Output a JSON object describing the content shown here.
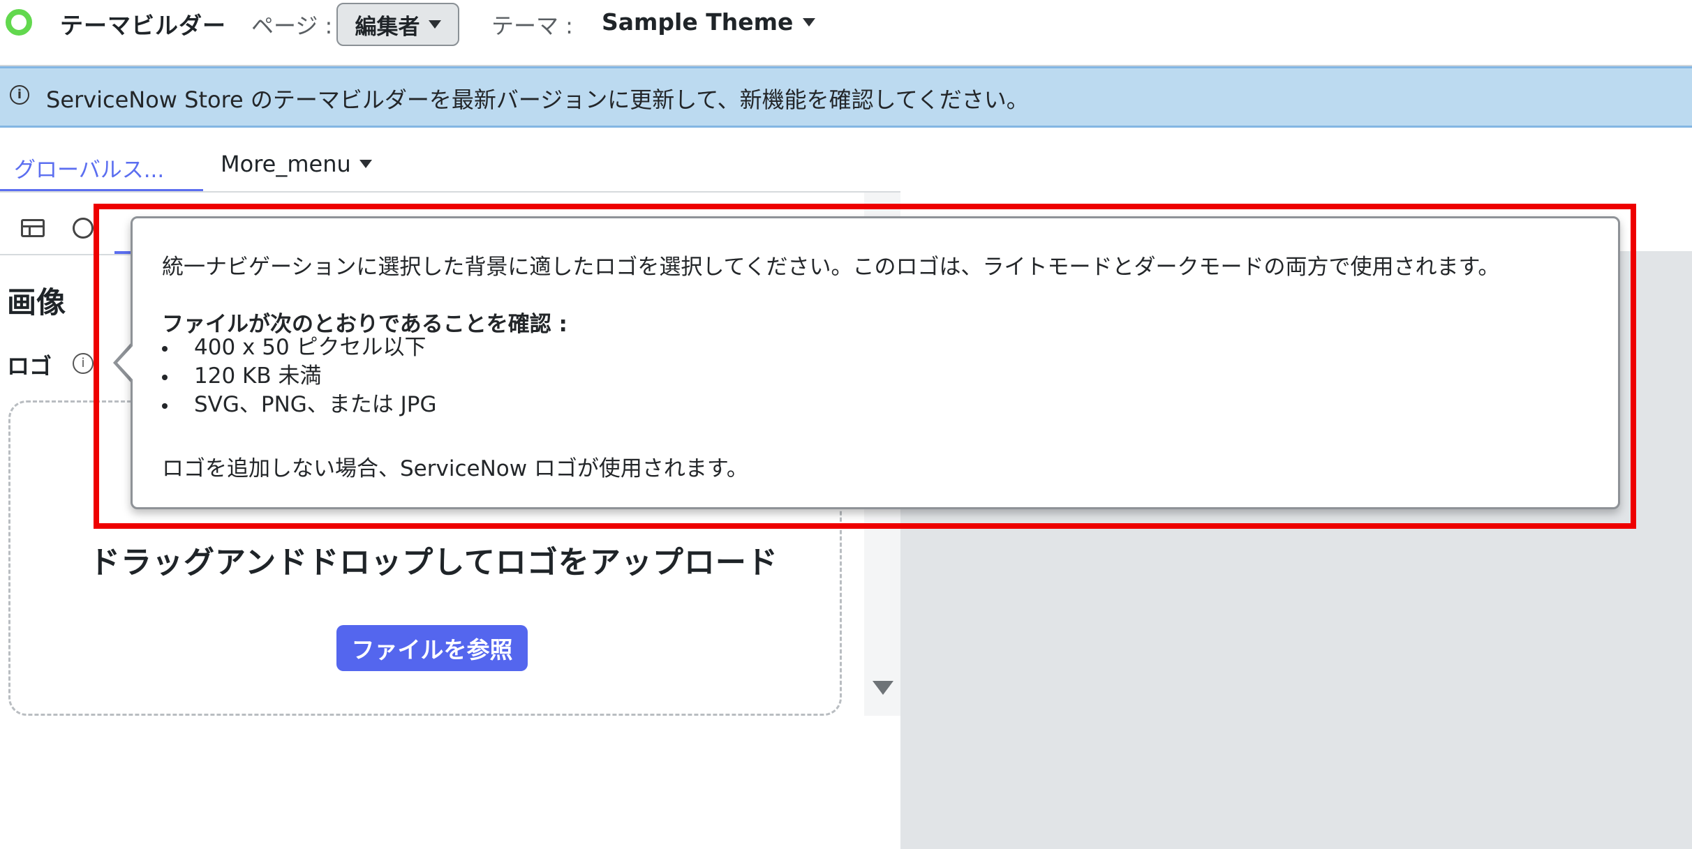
{
  "header": {
    "app_title": "テーマビルダー",
    "page_label": "ページ :",
    "page_value": "編集者",
    "theme_label": "テーマ :",
    "theme_value": "Sample Theme"
  },
  "banner": {
    "icon": "info-icon",
    "text": "ServiceNow Store のテーマビルダーを最新バージョンに更新して、新機能を確認してください。",
    "color": "#bcdaf0"
  },
  "tabs": [
    {
      "label": "グローバルス...",
      "active": true
    },
    {
      "label": "More_menu",
      "active": false
    }
  ],
  "panel": {
    "section_title": "画像",
    "logo_label": "ロゴ",
    "drop_text": "ドラッグアンドドロップしてロゴをアップロード",
    "browse_button": "ファイルを参照"
  },
  "tooltip": {
    "line1": "統一ナビゲーションに選択した背景に適したロゴを選択してください。このロゴは、ライトモードとダークモードの両方で使用されます。",
    "heading": "ファイルが次のとおりであることを確認 :",
    "items": [
      "400 x 50 ピクセル以下",
      "120 KB 未満",
      "SVG、PNG、または JPG"
    ],
    "footer": "ロゴを追加しない場合、ServiceNow ロゴが使用されます。"
  },
  "colors": {
    "accent": "#5b6ef0",
    "button": "#5466ee",
    "highlight": "#ee0000",
    "logo": "#62d84e",
    "preview_bg": "#e1e4e7"
  }
}
